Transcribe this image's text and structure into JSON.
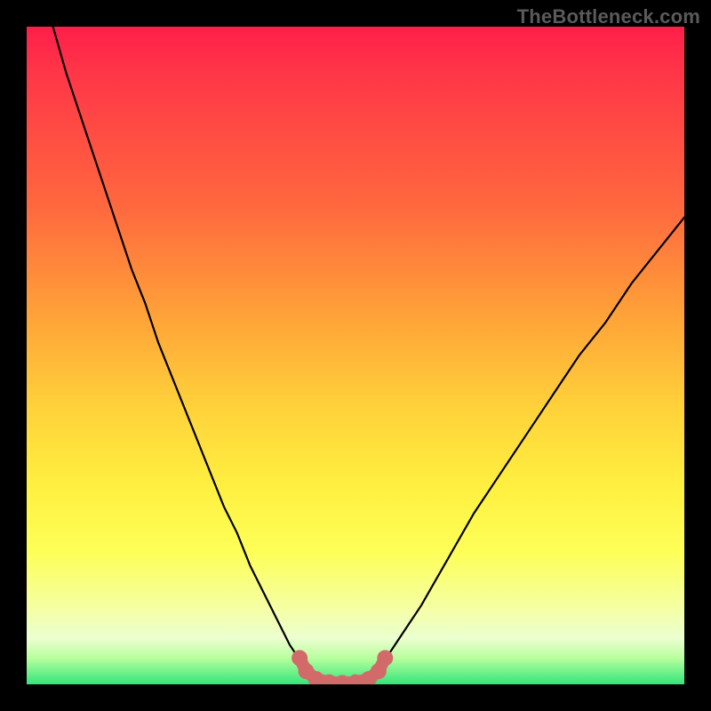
{
  "watermark": "TheBottleneck.com",
  "colors": {
    "page_bg": "#000000",
    "curve_stroke": "#000000",
    "marker_fill": "#d36a6a",
    "gradient_stops": [
      "#ff1e4a",
      "#ff3348",
      "#ff6a3e",
      "#ffa638",
      "#ffd23a",
      "#fff040",
      "#fdff58",
      "#f5ffa0",
      "#ecffd0",
      "#b8ff9e",
      "#33e57a"
    ]
  },
  "chart_data": {
    "type": "line",
    "title": "",
    "xlabel": "",
    "ylabel": "",
    "xlim": [
      0,
      100
    ],
    "ylim": [
      0,
      100
    ],
    "grid": false,
    "legend": false,
    "series": [
      {
        "name": "bottleneck-curve",
        "x": [
          4,
          6,
          8,
          10,
          12,
          14,
          16,
          18,
          20,
          22,
          24,
          26,
          28,
          30,
          32,
          34,
          36,
          38,
          40,
          42,
          44,
          46,
          48,
          50,
          52,
          54,
          56,
          58,
          60,
          64,
          68,
          72,
          76,
          80,
          84,
          88,
          92,
          96,
          100
        ],
        "y": [
          100,
          93,
          87,
          81,
          75,
          69,
          63,
          58,
          52,
          47,
          42,
          37,
          32,
          27,
          23,
          18,
          14,
          10,
          6,
          3,
          1,
          0.3,
          0.2,
          0.3,
          1,
          3,
          6,
          9,
          12,
          19,
          26,
          32,
          38,
          44,
          50,
          55,
          61,
          66,
          71
        ]
      }
    ],
    "markers": {
      "name": "optimal-region",
      "x": [
        41.5,
        42.5,
        44,
        46,
        48,
        50,
        52,
        53.5,
        54.5
      ],
      "y": [
        4.0,
        2.0,
        0.8,
        0.3,
        0.2,
        0.3,
        0.8,
        2.0,
        4.0
      ]
    },
    "annotations": []
  }
}
